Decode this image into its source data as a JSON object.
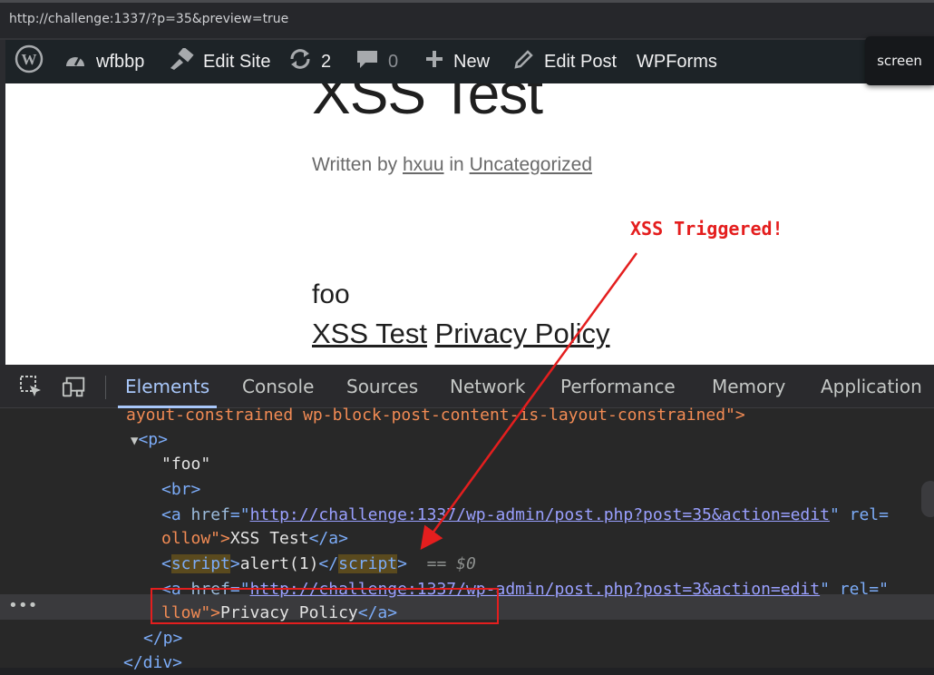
{
  "browser": {
    "url": "http://challenge:1337/?p=35&preview=true"
  },
  "admin_bar": {
    "wp_logo_icon": "wordpress-logo",
    "site_name": "wfbbp",
    "edit_site": "Edit Site",
    "updates_count": "2",
    "comments_count": "0",
    "new_label": "New",
    "edit_post": "Edit Post",
    "wpforms": "WPForms",
    "screen_label": "screen"
  },
  "post": {
    "title": "XSS Test",
    "byline_prefix": "Written by",
    "author": "hxuu",
    "byline_in": "in",
    "category": "Uncategorized",
    "content_text": "foo",
    "link1": "XSS Test",
    "link2": "Privacy Policy"
  },
  "annotation": {
    "label": "XSS Triggered!",
    "color": "#e41e1e"
  },
  "devtools": {
    "tabs": [
      "Elements",
      "Console",
      "Sources",
      "Network",
      "Performance",
      "Memory",
      "Application"
    ],
    "active_tab": "Elements",
    "lines": {
      "l0": "ayout-constrained wp-block-post-content-is-layout-constrained\">",
      "p_open": "<p>",
      "foo_text": "\"foo\"",
      "br": "<br>",
      "a1_open": "<a ",
      "a1_attr": "href",
      "a1_eq": "=\"",
      "a1_href": "http://challenge:1337/wp-admin/post.php?post=35&action=edit",
      "a1_rest": "\" rel=",
      "a1_cont": "ollow\">",
      "a1_text": "XSS Test",
      "a1_close": "</a>",
      "script_open_lt": "<",
      "script_name": "script",
      "script_gt": ">",
      "script_body": "alert(1)",
      "script_close_lt": "</",
      "script_close_gt": ">",
      "eq_marker": "== $0",
      "a2_open": "<a ",
      "a2_attr": "href",
      "a2_eq": "=\"",
      "a2_href": "http://challenge:1337/wp-admin/post.php?post=3&action=edit",
      "a2_rest": "\" rel=\"",
      "a2_cont": "llow\">",
      "a2_text": "Privacy Policy",
      "a2_close": "</a>",
      "p_close": "</p>",
      "div_close": "</div>"
    },
    "row_menu": "•••"
  }
}
